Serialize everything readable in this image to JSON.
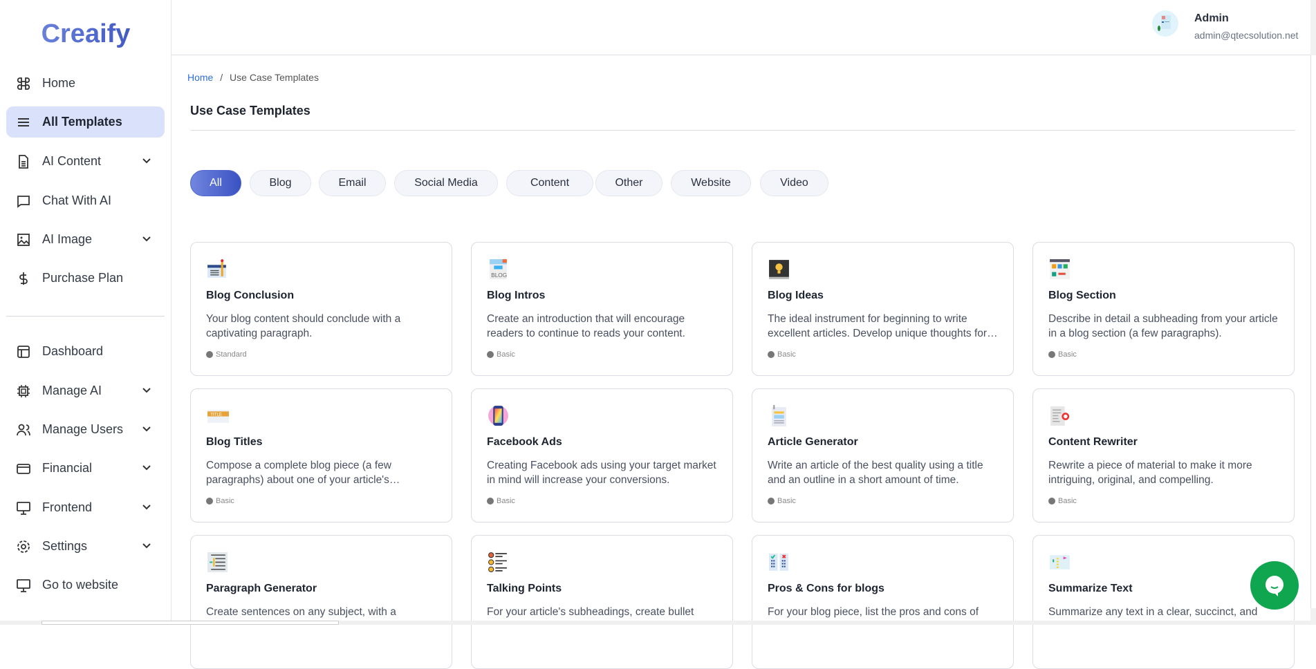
{
  "brand": "Creaify",
  "sidebar": {
    "items": [
      {
        "label": "Home",
        "icon": "command-icon",
        "chev": false
      },
      {
        "label": "All Templates",
        "icon": "menu-icon",
        "chev": false,
        "active": true
      },
      {
        "label": "AI Content",
        "icon": "document-icon",
        "chev": true
      },
      {
        "label": "Chat With AI",
        "icon": "chat-icon",
        "chev": false
      },
      {
        "label": "AI Image",
        "icon": "image-icon",
        "chev": true
      },
      {
        "label": "Purchase Plan",
        "icon": "dollar-icon",
        "chev": false
      },
      {
        "label": "Dashboard",
        "icon": "layout-icon",
        "chev": false
      },
      {
        "label": "Manage AI",
        "icon": "cpu-icon",
        "chev": true
      },
      {
        "label": "Manage Users",
        "icon": "users-icon",
        "chev": true
      },
      {
        "label": "Financial",
        "icon": "credit-card-icon",
        "chev": true
      },
      {
        "label": "Frontend",
        "icon": "monitor-icon",
        "chev": true
      },
      {
        "label": "Settings",
        "icon": "gear-icon",
        "chev": true
      },
      {
        "label": "Go to website",
        "icon": "monitor-icon",
        "chev": false
      }
    ]
  },
  "user": {
    "name": "Admin",
    "email": "admin@qtecsolution.net"
  },
  "breadcrumb": {
    "home": "Home",
    "sep": "/",
    "current": "Use Case Templates"
  },
  "page_title": "Use Case Templates",
  "filters": [
    "All",
    "Blog",
    "Email",
    "Social Media",
    "Content",
    "Other",
    "Website",
    "Video"
  ],
  "cards": [
    {
      "title": "Blog Conclusion",
      "desc": "Your blog content should conclude with a captivating paragraph.",
      "badge": "Standard"
    },
    {
      "title": "Blog Intros",
      "desc": "Create an introduction that will encourage readers to continue to reads your content.",
      "badge": "Basic"
    },
    {
      "title": "Blog Ideas",
      "desc": "The ideal instrument for beginning to write excellent articles. Develop unique thoughts for your blog.",
      "badge": "Basic"
    },
    {
      "title": "Blog Section",
      "desc": "Describe in detail a subheading from your article in a blog section (a few paragraphs).",
      "badge": "Basic"
    },
    {
      "title": "Blog Titles",
      "desc": "Compose a complete blog piece (a few paragraphs) about one of your article's subheadings.",
      "badge": "Basic"
    },
    {
      "title": "Facebook Ads",
      "desc": "Creating Facebook ads using your target market in mind will increase your conversions.",
      "badge": "Basic"
    },
    {
      "title": "Article Generator",
      "desc": "Write an article of the best quality using a title and an outline in a short amount of time.",
      "badge": "Basic"
    },
    {
      "title": "Content Rewriter",
      "desc": "Rewrite a piece of material to make it more intriguing, original, and compelling.",
      "badge": "Basic"
    },
    {
      "title": "Paragraph Generator",
      "desc": "Create sentences on any subject, with a",
      "badge": ""
    },
    {
      "title": "Talking Points",
      "desc": "For your article's subheadings, create bullet",
      "badge": ""
    },
    {
      "title": "Pros & Cons for blogs",
      "desc": "For your blog piece, list the pros and cons of",
      "badge": ""
    },
    {
      "title": "Summarize Text",
      "desc": "Summarize any text in a clear, succinct, and",
      "badge": ""
    }
  ],
  "colors": {
    "accent": "#3a52c2",
    "active_bg": "#dae2fb",
    "chat": "#10a650"
  }
}
